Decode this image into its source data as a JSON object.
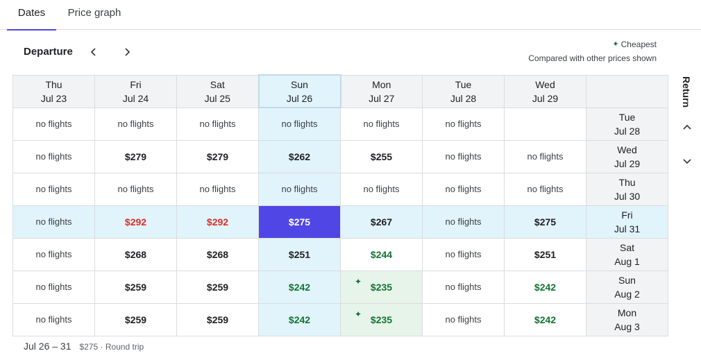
{
  "tabs": [
    {
      "label": "Dates",
      "active": true
    },
    {
      "label": "Price graph",
      "active": false
    }
  ],
  "departure": {
    "label": "Departure"
  },
  "return_label": "Return",
  "legend": {
    "cheapest": "Cheapest",
    "compare": "Compared with other prices shown"
  },
  "columns": [
    {
      "day": "Thu",
      "date": "Jul 23"
    },
    {
      "day": "Fri",
      "date": "Jul 24"
    },
    {
      "day": "Sat",
      "date": "Jul 25"
    },
    {
      "day": "Sun",
      "date": "Jul 26"
    },
    {
      "day": "Mon",
      "date": "Jul 27"
    },
    {
      "day": "Tue",
      "date": "Jul 28"
    },
    {
      "day": "Wed",
      "date": "Jul 29"
    }
  ],
  "rows": [
    {
      "day": "Tue",
      "date": "Jul 28",
      "cells": [
        "no flights",
        "no flights",
        "no flights",
        "no flights",
        "no flights",
        "no flights",
        ""
      ]
    },
    {
      "day": "Wed",
      "date": "Jul 29",
      "cells": [
        "no flights",
        "$279",
        "$279",
        "$262",
        "$255",
        "no flights",
        "no flights"
      ]
    },
    {
      "day": "Thu",
      "date": "Jul 30",
      "cells": [
        "no flights",
        "no flights",
        "no flights",
        "no flights",
        "no flights",
        "no flights",
        "no flights"
      ]
    },
    {
      "day": "Fri",
      "date": "Jul 31",
      "cells": [
        "no flights",
        "$292",
        "$292",
        "$275",
        "$267",
        "no flights",
        "$275"
      ]
    },
    {
      "day": "Sat",
      "date": "Aug 1",
      "cells": [
        "no flights",
        "$268",
        "$268",
        "$251",
        "$244",
        "no flights",
        "$251"
      ]
    },
    {
      "day": "Sun",
      "date": "Aug 2",
      "cells": [
        "no flights",
        "$259",
        "$259",
        "$242",
        "$235",
        "no flights",
        "$242"
      ]
    },
    {
      "day": "Mon",
      "date": "Aug 3",
      "cells": [
        "no flights",
        "$259",
        "$259",
        "$242",
        "$235",
        "no flights",
        "$242"
      ]
    }
  ],
  "footer": {
    "range": "Jul 26 – 31",
    "detail": "$275 · Round trip"
  },
  "colors": {
    "accent": "#5046e5",
    "cheap": "#137333",
    "expensive": "#d93025",
    "selected_band": "#e1f3fb"
  }
}
